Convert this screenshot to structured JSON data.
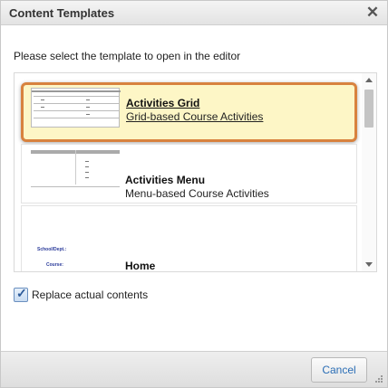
{
  "dialog": {
    "title": "Content Templates",
    "close_label": "✕",
    "instruction": "Please select the template to open in the editor"
  },
  "templates": [
    {
      "title": "Activities Grid",
      "description": "Grid-based Course Activities",
      "selected": true
    },
    {
      "title": "Activities Menu",
      "description": "Menu-based Course Activities",
      "selected": false
    },
    {
      "title": "Home",
      "description": "",
      "selected": false
    }
  ],
  "thumb_home": {
    "line1": "School/Dept.:",
    "line2": "Course:"
  },
  "options": {
    "replace_label": "Replace actual contents",
    "replace_checked": true
  },
  "footer": {
    "cancel_label": "Cancel"
  },
  "colors": {
    "selected_border": "#d8823e",
    "selected_bg": "#fdf6c6",
    "cancel_text": "#2a6db5"
  }
}
